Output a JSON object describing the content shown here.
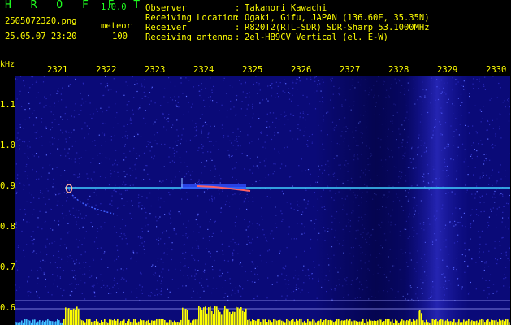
{
  "header": {
    "app_title": "H R O F F T",
    "version": "1.0.0",
    "filename": "2505072320.png",
    "detection_type": "meteor",
    "datetime": "25.05.07 23:20",
    "count": "100"
  },
  "meta": [
    {
      "key": "Observer",
      "value": "Takanori Kawachi"
    },
    {
      "key": "Receiving Location",
      "value": "Ogaki, Gifu, JAPAN (136.60E, 35.35N)"
    },
    {
      "key": "Receiver",
      "value": "R820T2(RTL-SDR) SDR-Sharp 53.1000MHz"
    },
    {
      "key": "Receiving antenna",
      "value": "2el-HB9CV Vertical (el. E-W)"
    }
  ],
  "axes": {
    "y_unit": "kHz",
    "x_ticks": [
      "2321",
      "2322",
      "2323",
      "2324",
      "2325",
      "2326",
      "2327",
      "2328",
      "2329",
      "2330"
    ],
    "y_ticks": [
      "1.1",
      "1.0",
      "0.9",
      "0.8",
      "0.7",
      "0.6"
    ]
  },
  "colors": {
    "background": "#000000",
    "spectrogram_base": "#0a0a78",
    "carrier_line": "#40d0ff",
    "meteor_trail": "#ff6060",
    "level_bars": "#ffff00",
    "title_green": "#20ff20"
  }
}
